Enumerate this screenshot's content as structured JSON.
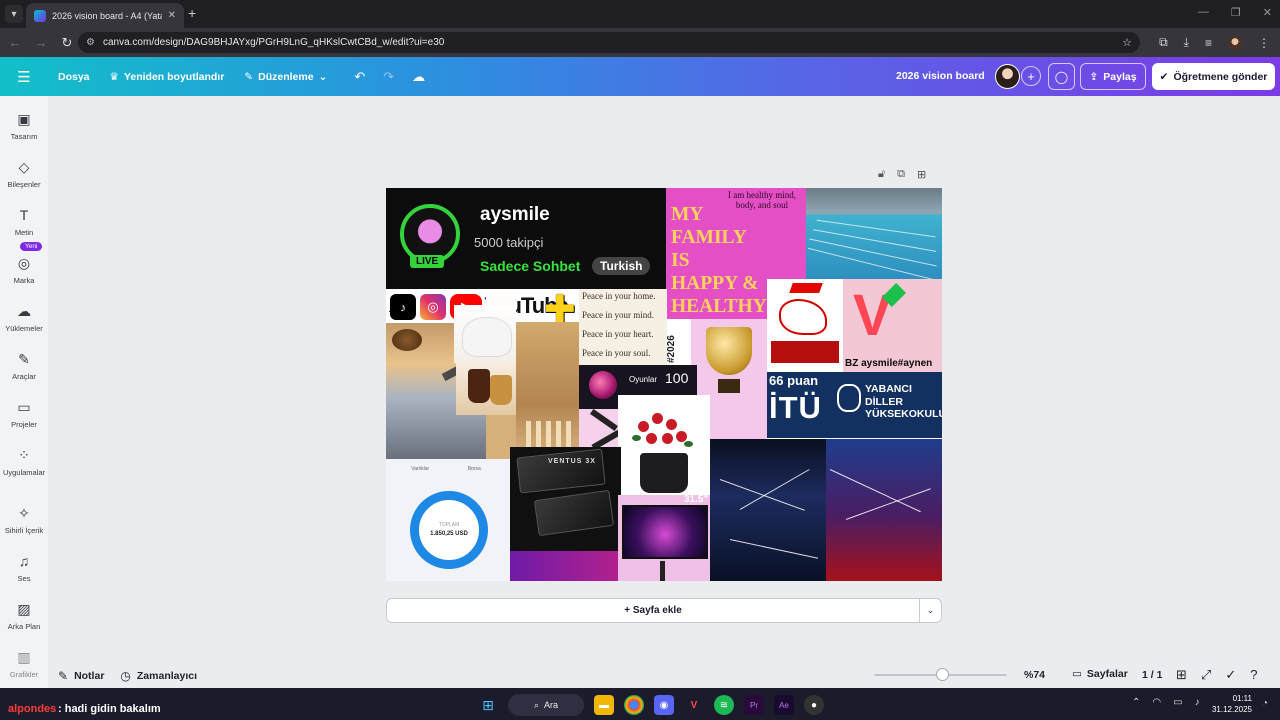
{
  "browser": {
    "tab_title": "2026 vision board - A4 (Yatay)",
    "url": "canva.com/design/DAG9BHJAYxg/PGrH9LnG_qHKslCwtCBd_w/edit?ui=e30"
  },
  "header": {
    "file_label": "Dosya",
    "resize_label": "Yeniden boyutlandır",
    "edit_label": "Düzenleme",
    "design_title": "2026 vision board",
    "share_label": "Paylaş",
    "teacher_label": "Öğretmene gönder"
  },
  "sidebar": {
    "new_badge": "Yeni",
    "items": [
      {
        "label": "Tasarım",
        "icon": "design-icon"
      },
      {
        "label": "Bileşenler",
        "icon": "elements-icon"
      },
      {
        "label": "Metin",
        "icon": "text-icon"
      },
      {
        "label": "Marka",
        "icon": "brand-icon"
      },
      {
        "label": "Yüklemeler",
        "icon": "upload-icon"
      },
      {
        "label": "Araçlar",
        "icon": "tools-icon"
      },
      {
        "label": "Projeler",
        "icon": "folder-icon"
      },
      {
        "label": "Uygulamalar",
        "icon": "apps-icon"
      },
      {
        "label": "Sihirli İçerik",
        "icon": "magic-icon"
      },
      {
        "label": "Ses",
        "icon": "audio-icon"
      },
      {
        "label": "Arka Plan",
        "icon": "background-icon"
      },
      {
        "label": "Grafikler",
        "icon": "charts-icon"
      }
    ]
  },
  "board": {
    "stream": {
      "live": "LIVE",
      "name": "aysmile",
      "followers": "5000 takipçi",
      "chat": "Sadece Sohbet",
      "language": "Turkish"
    },
    "family": {
      "note": "I am healthy mind, body, and soul",
      "lines": [
        "MY",
        "FAMILY",
        "IS",
        "HAPPY &",
        "HEALTHY"
      ]
    },
    "social": {
      "tiktok": "TikTok",
      "youtube": "YouTube"
    },
    "peace": [
      "Peace in your home.",
      "Peace in your mind.",
      "Peace in your heart.",
      "Peace in your soul."
    ],
    "year_tag": "#2026",
    "games": {
      "label": "Oyunlar",
      "count": "100"
    },
    "handle": "BZ aysmile#aynen",
    "itu": {
      "score": "66 puan",
      "name": "İTÜ",
      "school": [
        "YABANCI",
        "DİLLER",
        "YÜKSEKOKULU"
      ]
    },
    "wallet": {
      "tabs": [
        "Varlıklar",
        "Borsa"
      ],
      "total_label": "TOPLAM",
      "total_value": "1.850,25 USD"
    },
    "monitor_size": "31.5\"",
    "gpu_brand": "VENTUS 3X"
  },
  "canvas": {
    "add_page": "+ Sayfa ekle"
  },
  "footer": {
    "notes": "Notlar",
    "timer": "Zamanlayıcı",
    "zoom": "%74",
    "zoom_level": 0.74,
    "pages": "Sayfalar",
    "page_count": "1 / 1"
  },
  "taskbar": {
    "search": "Ara",
    "time": "01:11",
    "date": "31.12.2025",
    "chat_user": "alpondes",
    "chat_msg": ": hadi gidin bakalım"
  }
}
